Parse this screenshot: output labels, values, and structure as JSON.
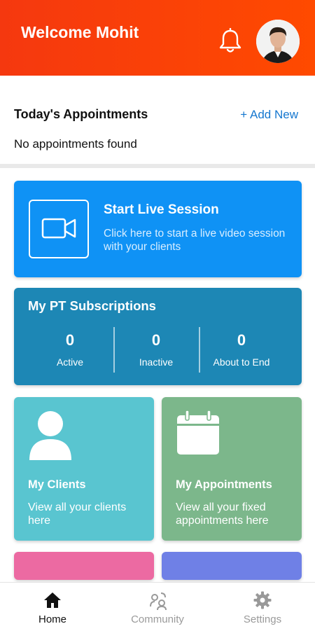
{
  "header": {
    "welcome_text": "Welcome Mohit",
    "bg_color": "#ff4a00"
  },
  "appointments": {
    "title": "Today's Appointments",
    "add_new_label": "+ Add New",
    "empty_text": "No appointments found"
  },
  "live_session": {
    "title": "Start Live Session",
    "subtitle": "Click here to start a live video session with your clients",
    "icon": "video-camera-icon",
    "color": "#0f92f5"
  },
  "pt_subscriptions": {
    "title": "My PT Subscriptions",
    "color": "#1d87b5",
    "stats": [
      {
        "value": "0",
        "label": "Active"
      },
      {
        "value": "0",
        "label": "Inactive"
      },
      {
        "value": "0",
        "label": "About to End"
      }
    ]
  },
  "tiles": [
    {
      "title": "My Clients",
      "subtitle": "View all your clients here",
      "icon": "user-icon",
      "color": "#59c5d0"
    },
    {
      "title": "My Appointments",
      "subtitle": "View all your fixed appointments here",
      "icon": "calendar-icon",
      "color": "#7cb78b"
    }
  ],
  "bottom_nav": [
    {
      "label": "Home",
      "icon": "home-icon",
      "active": true
    },
    {
      "label": "Community",
      "icon": "community-icon",
      "active": false
    },
    {
      "label": "Settings",
      "icon": "gear-icon",
      "active": false
    }
  ]
}
